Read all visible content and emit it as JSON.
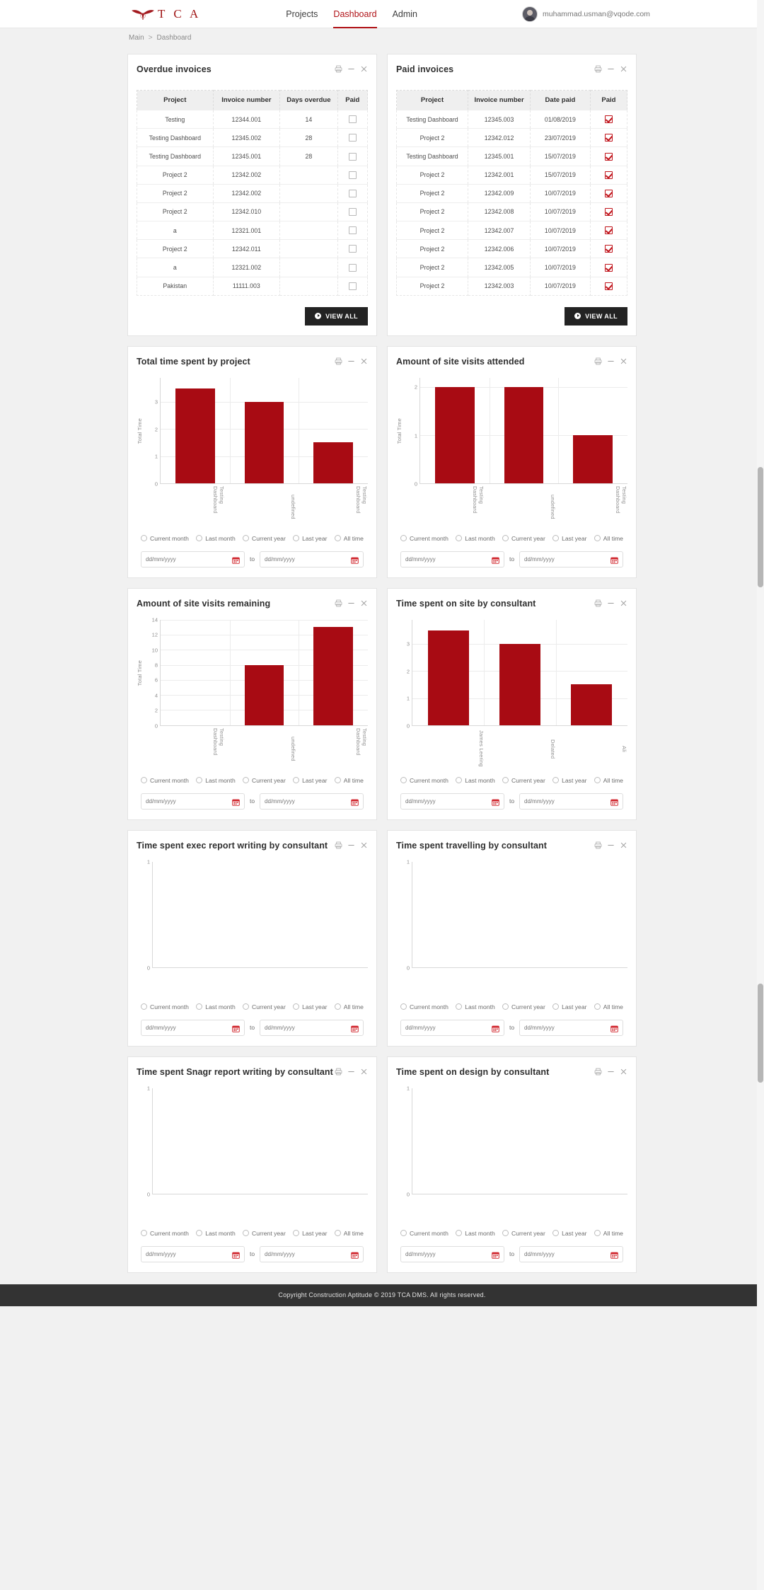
{
  "header": {
    "logo_text": "T C A",
    "logo_icon": "bird-wing-logo",
    "nav": [
      {
        "label": "Projects",
        "active": false
      },
      {
        "label": "Dashboard",
        "active": true
      },
      {
        "label": "Admin",
        "active": false
      }
    ],
    "user_email": "muhammad.usman@vqode.com"
  },
  "breadcrumb": {
    "root": "Main",
    "separator": ">",
    "current": "Dashboard"
  },
  "common": {
    "view_all": "VIEW ALL",
    "to": "to",
    "date_placeholder": "dd/mm/yyyy",
    "tools": [
      "print-icon",
      "minimize-icon",
      "close-icon"
    ],
    "radio_options": [
      "Current month",
      "Last month",
      "Current year",
      "Last year",
      "All time"
    ],
    "accent_color": "#a80b13",
    "brand_red": "#b01116",
    "dark_button": "#232323"
  },
  "cards": {
    "overdue": {
      "title": "Overdue invoices",
      "columns": [
        "Project",
        "Invoice number",
        "Days overdue",
        "Paid"
      ],
      "rows": [
        {
          "project": "Testing",
          "invoice": "12344.001",
          "days": "14",
          "paid": false
        },
        {
          "project": "Testing Dashboard",
          "invoice": "12345.002",
          "days": "28",
          "paid": false
        },
        {
          "project": "Testing Dashboard",
          "invoice": "12345.001",
          "days": "28",
          "paid": false
        },
        {
          "project": "Project 2",
          "invoice": "12342.002",
          "days": "",
          "paid": false
        },
        {
          "project": "Project 2",
          "invoice": "12342.002",
          "days": "",
          "paid": false
        },
        {
          "project": "Project 2",
          "invoice": "12342.010",
          "days": "",
          "paid": false
        },
        {
          "project": "a",
          "invoice": "12321.001",
          "days": "",
          "paid": false
        },
        {
          "project": "Project 2",
          "invoice": "12342.011",
          "days": "",
          "paid": false
        },
        {
          "project": "a",
          "invoice": "12321.002",
          "days": "",
          "paid": false
        },
        {
          "project": "Pakistan",
          "invoice": "11111.003",
          "days": "",
          "paid": false
        }
      ]
    },
    "paid": {
      "title": "Paid invoices",
      "columns": [
        "Project",
        "Invoice number",
        "Date paid",
        "Paid"
      ],
      "rows": [
        {
          "project": "Testing Dashboard",
          "invoice": "12345.003",
          "date": "01/08/2019",
          "paid": true
        },
        {
          "project": "Project 2",
          "invoice": "12342.012",
          "date": "23/07/2019",
          "paid": true
        },
        {
          "project": "Testing Dashboard",
          "invoice": "12345.001",
          "date": "15/07/2019",
          "paid": true
        },
        {
          "project": "Project 2",
          "invoice": "12342.001",
          "date": "15/07/2019",
          "paid": true
        },
        {
          "project": "Project 2",
          "invoice": "12342.009",
          "date": "10/07/2019",
          "paid": true
        },
        {
          "project": "Project 2",
          "invoice": "12342.008",
          "date": "10/07/2019",
          "paid": true
        },
        {
          "project": "Project 2",
          "invoice": "12342.007",
          "date": "10/07/2019",
          "paid": true
        },
        {
          "project": "Project 2",
          "invoice": "12342.006",
          "date": "10/07/2019",
          "paid": true
        },
        {
          "project": "Project 2",
          "invoice": "12342.005",
          "date": "10/07/2019",
          "paid": true
        },
        {
          "project": "Project 2",
          "invoice": "12342.003",
          "date": "10/07/2019",
          "paid": true
        }
      ]
    }
  },
  "chart_data": [
    {
      "id": "total-time-by-project",
      "type": "bar",
      "title": "Total time spent by project",
      "categories": [
        "Testing Dashboard",
        "undefined",
        "Testing Dashboard"
      ],
      "values": [
        3.5,
        3.0,
        1.5
      ],
      "xlabel": "",
      "ylabel": "Total Time",
      "yticks": [
        0,
        1,
        2,
        3
      ],
      "ylim": [
        0,
        3.9
      ],
      "grid": true
    },
    {
      "id": "site-visits-attended",
      "type": "bar",
      "title": "Amount of site visits attended",
      "categories": [
        "Testing Dashboard",
        "undefined",
        "Testing Dashboard"
      ],
      "values": [
        2.0,
        2.0,
        1.0
      ],
      "xlabel": "",
      "ylabel": "Total Time",
      "yticks": [
        0,
        1,
        2
      ],
      "ylim": [
        0,
        2.2
      ],
      "grid": true
    },
    {
      "id": "site-visits-remaining",
      "type": "bar",
      "title": "Amount of site visits remaining",
      "categories": [
        "Testing Dashboard",
        "undefined",
        "Testing Dashboard"
      ],
      "values": [
        0,
        8,
        13
      ],
      "xlabel": "",
      "ylabel": "Total Time",
      "yticks": [
        0,
        2,
        4,
        6,
        8,
        10,
        12,
        14
      ],
      "ylim": [
        0,
        14
      ],
      "grid": true
    },
    {
      "id": "time-on-site-by-consultant",
      "type": "bar",
      "title": "Time spent on site by consultant",
      "categories": [
        "James Leering",
        "Delated",
        "Ali"
      ],
      "values": [
        3.5,
        3.0,
        1.5
      ],
      "xlabel": "",
      "ylabel": "",
      "yticks": [
        0,
        1,
        2,
        3
      ],
      "ylim": [
        0,
        3.9
      ],
      "grid": true
    },
    {
      "id": "exec-report-writing",
      "type": "bar",
      "title": "Time spent exec report writing by consultant",
      "categories": [],
      "values": [],
      "xlabel": "",
      "ylabel": "",
      "yticks": [
        0,
        1
      ],
      "ylim": [
        0,
        1
      ],
      "grid": false
    },
    {
      "id": "travelling-by-consultant",
      "type": "bar",
      "title": "Time spent travelling by consultant",
      "categories": [],
      "values": [],
      "xlabel": "",
      "ylabel": "",
      "yticks": [
        0,
        1
      ],
      "ylim": [
        0,
        1
      ],
      "grid": false
    },
    {
      "id": "snagr-report-writing",
      "type": "bar",
      "title": "Time spent Snagr report writing by consultant",
      "categories": [],
      "values": [],
      "xlabel": "",
      "ylabel": "",
      "yticks": [
        0,
        1
      ],
      "ylim": [
        0,
        1
      ],
      "grid": false
    },
    {
      "id": "time-on-design",
      "type": "bar",
      "title": "Time spent on design by consultant",
      "categories": [],
      "values": [],
      "xlabel": "",
      "ylabel": "",
      "yticks": [
        0,
        1
      ],
      "ylim": [
        0,
        1
      ],
      "grid": false
    }
  ],
  "footer": {
    "text": "Copyright Construction Aptitude © 2019 TCA DMS. All rights reserved."
  }
}
